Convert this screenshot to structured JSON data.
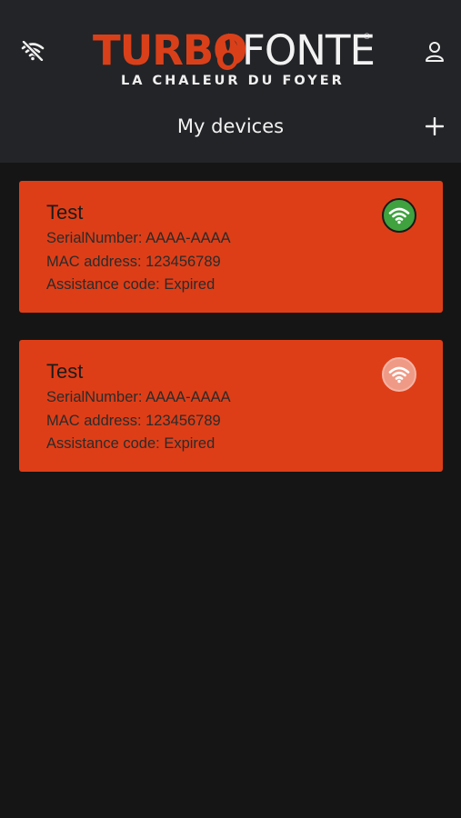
{
  "header": {
    "logo": {
      "brand_part1": "TURBO",
      "brand_part2": "FONTE",
      "registered": "®",
      "tagline": "LA CHALEUR DU FOYER"
    },
    "title": "My devices",
    "connection_icon": "wifi-off-icon",
    "account_icon": "user-icon",
    "add_icon": "plus-icon"
  },
  "devices": [
    {
      "name": "Test",
      "serial": "SerialNumber: AAAA-AAAA",
      "mac": "MAC address: 123456789",
      "assistance": "Assistance code: Expired",
      "status": "online",
      "status_icon": "wifi-icon",
      "status_color": "#3fa23f"
    },
    {
      "name": "Test",
      "serial": "SerialNumber: AAAA-AAAA",
      "mac": "MAC address: 123456789",
      "assistance": "Assistance code: Expired",
      "status": "offline",
      "status_icon": "wifi-icon",
      "status_color": "#ef9a86"
    }
  ],
  "colors": {
    "background": "#151515",
    "header": "#232427",
    "accent": "#de3e17",
    "brand_text": "#d9401a"
  }
}
